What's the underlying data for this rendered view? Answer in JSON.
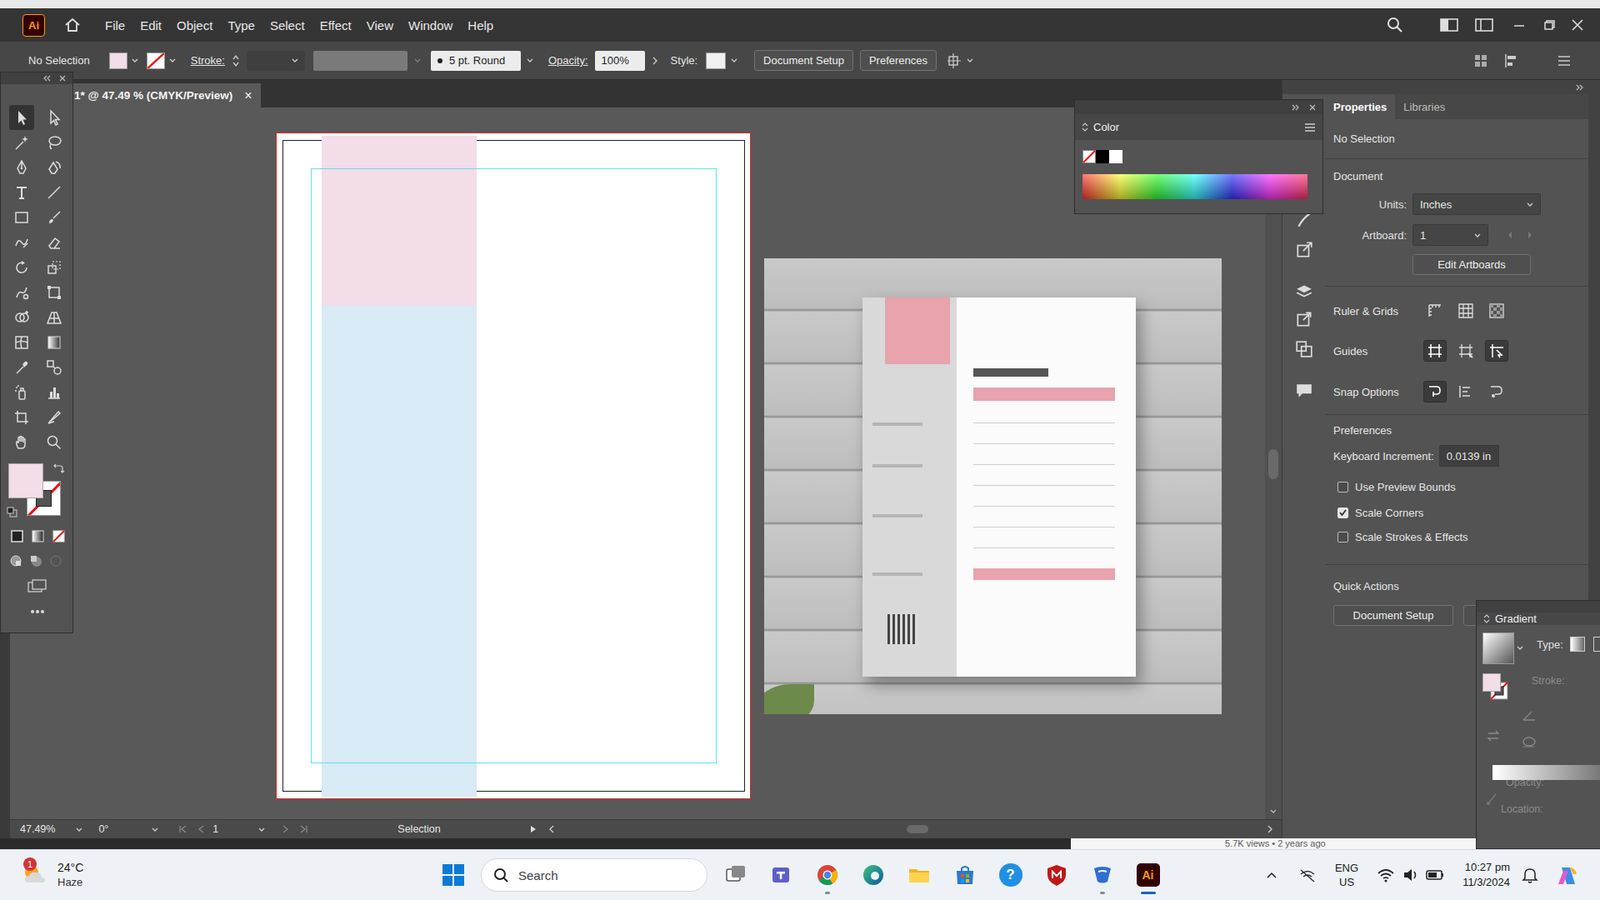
{
  "app": {
    "logo": "Ai",
    "menu": [
      "File",
      "Edit",
      "Object",
      "Type",
      "Select",
      "Effect",
      "View",
      "Window",
      "Help"
    ]
  },
  "control_bar": {
    "selection": "No Selection",
    "fill": {
      "color": "#f2dde8"
    },
    "stroke": {
      "none": true
    },
    "stroke_label": "Stroke:",
    "brush": "5 pt. Round",
    "opacity_label": "Opacity:",
    "opacity": "100%",
    "style_label": "Style:",
    "buttons": [
      "Document Setup",
      "Preferences"
    ]
  },
  "document_tab": {
    "title": "1* @ 47.49 % (CMYK/Preview)",
    "close": "×",
    "selected": true
  },
  "tools": [
    {
      "selected": true
    },
    {
      "selected": false
    },
    {
      "selected": false
    },
    {
      "selected": false
    },
    {
      "selected": false
    },
    {
      "selected": false
    },
    {
      "selected": false
    },
    {
      "selected": false
    },
    {
      "selected": false
    },
    {
      "selected": false
    },
    {
      "selected": false
    },
    {
      "selected": false
    },
    {
      "selected": false
    },
    {
      "selected": false
    },
    {
      "selected": false
    },
    {
      "selected": false
    },
    {
      "selected": false
    },
    {
      "selected": false
    },
    {
      "selected": false
    },
    {
      "selected": false
    },
    {
      "selected": false
    },
    {
      "selected": false
    },
    {
      "selected": false
    },
    {
      "selected": false
    },
    {
      "selected": false
    },
    {
      "selected": false
    },
    {
      "selected": false
    },
    {
      "selected": false
    }
  ],
  "toolbar": {
    "fill": {
      "color": "#f2dde8"
    },
    "stroke": {
      "none": true
    }
  },
  "color_panel": {
    "title": "Color"
  },
  "properties": {
    "tabs": [
      {
        "label": "Properties",
        "selected": true
      },
      {
        "label": "Libraries",
        "selected": false
      }
    ],
    "selection": "No Selection",
    "document_heading": "Document",
    "units_label": "Units:",
    "units": "Inches",
    "artboard_label": "Artboard:",
    "artboard": "1",
    "edit_artboards": "Edit Artboards",
    "rows": [
      {
        "label": "Ruler & Grids",
        "toggles": [
          {
            "on": false
          },
          {
            "on": false
          },
          {
            "on": false
          }
        ]
      },
      {
        "label": "Guides",
        "toggles": [
          {
            "on": true
          },
          {
            "on": false
          },
          {
            "on": true
          }
        ]
      },
      {
        "label": "Snap Options",
        "toggles": [
          {
            "on": true
          },
          {
            "on": false
          },
          {
            "on": false
          }
        ]
      }
    ],
    "preferences_heading": "Preferences",
    "keyboard_increment_label": "Keyboard Increment:",
    "keyboard_increment": "0.0139 in",
    "checkboxes": [
      {
        "label": "Use Preview Bounds",
        "checked": false
      },
      {
        "label": "Scale Corners",
        "checked": true
      },
      {
        "label": "Scale Strokes & Effects",
        "checked": false
      }
    ],
    "quick_actions_heading": "Quick Actions",
    "quick_actions": [
      "Document Setup"
    ]
  },
  "gradient_panel": {
    "title": "Gradient",
    "type_label": "Type:",
    "fields": [
      {
        "label": "Stroke:",
        "disabled": true
      },
      {
        "label": "Opacity:",
        "disabled": true
      },
      {
        "label": "Location:",
        "disabled": true
      }
    ]
  },
  "status_bar": {
    "zoom": "47.49%",
    "rotation": "0°",
    "artboard": "1",
    "tool": "Selection"
  },
  "background_window": {
    "text": "5.7K views • 2 years ago"
  },
  "taskbar": {
    "weather": {
      "badge": "1",
      "temperature": "24°C",
      "condition": "Haze"
    },
    "search": {
      "placeholder": "Search"
    },
    "apps": [
      {
        "kind": "taskview",
        "running": false,
        "selected": false
      },
      {
        "kind": "teams",
        "running": false,
        "selected": false
      },
      {
        "kind": "chrome",
        "running": true,
        "selected": false
      },
      {
        "kind": "edge",
        "running": false,
        "selected": false
      },
      {
        "kind": "explorer",
        "running": false,
        "selected": false
      },
      {
        "kind": "store",
        "running": false,
        "selected": false
      },
      {
        "kind": "help",
        "label": "?",
        "running": false,
        "selected": false
      },
      {
        "kind": "mcafee",
        "running": false,
        "selected": false
      },
      {
        "kind": "remote",
        "running": true,
        "selected": false
      },
      {
        "kind": "illustrator",
        "label": "Ai",
        "running": true,
        "selected": true
      }
    ],
    "language": "ENG",
    "region": "US",
    "time": "10:27 pm",
    "date": "11/3/2024"
  }
}
